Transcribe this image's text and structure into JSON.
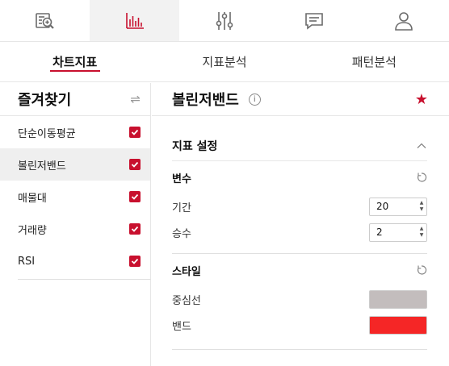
{
  "icons": [
    {
      "name": "search-document-icon",
      "active": false
    },
    {
      "name": "bar-chart-icon",
      "active": true
    },
    {
      "name": "sliders-icon",
      "active": false
    },
    {
      "name": "chat-icon",
      "active": false
    },
    {
      "name": "user-icon",
      "active": false
    }
  ],
  "tabs": [
    {
      "label": "차트지표",
      "active": true
    },
    {
      "label": "지표분석",
      "active": false
    },
    {
      "label": "패턴분석",
      "active": false
    }
  ],
  "favorites": {
    "title": "즐겨찾기",
    "swap_symbol": "⇌",
    "items": [
      {
        "label": "단순이동평균",
        "checked": true,
        "active": false
      },
      {
        "label": "볼린저밴드",
        "checked": true,
        "active": true
      },
      {
        "label": "매물대",
        "checked": true,
        "active": false
      },
      {
        "label": "거래량",
        "checked": true,
        "active": false
      },
      {
        "label": "RSI",
        "checked": true,
        "active": false
      }
    ]
  },
  "detail": {
    "title": "볼린저밴드",
    "info_symbol": "i",
    "star_symbol": "★",
    "settings_title": "지표 설정",
    "variables": {
      "title": "변수",
      "period_label": "기간",
      "period_value": "20",
      "multiplier_label": "승수",
      "multiplier_value": "2"
    },
    "style": {
      "title": "스타일",
      "center_label": "중심선",
      "center_color": "#c3bdbd",
      "band_label": "밴드",
      "band_color": "#f52626"
    }
  },
  "colors": {
    "accent": "#c8102e"
  }
}
